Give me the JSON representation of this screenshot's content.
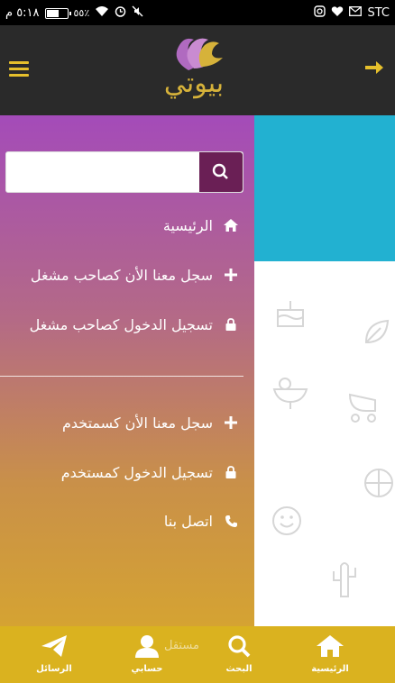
{
  "status_bar": {
    "time": "٥:١٨ م",
    "battery_percent_text": "٥٥٪",
    "battery_level": 0.55,
    "carrier": "STC"
  },
  "header": {
    "logo_text": "بيوتي"
  },
  "drawer": {
    "search": {
      "placeholder": "",
      "value": ""
    },
    "items": [
      {
        "label": "الرئيسية",
        "icon": "home-icon"
      },
      {
        "label": "سجل معنا الأن كصاحب مشغل",
        "icon": "plus-icon"
      },
      {
        "label": "تسجيل الدخول كصاحب مشغل",
        "icon": "lock-icon"
      },
      {
        "label": "سجل معنا الأن كسمتخدم",
        "icon": "plus-icon"
      },
      {
        "label": "تسجيل الدخول كمستخدم",
        "icon": "lock-icon"
      },
      {
        "label": "اتصل بنا",
        "icon": "phone-icon"
      }
    ]
  },
  "bottom_nav": {
    "items": [
      {
        "label": "الرئيسية",
        "icon": "home-icon"
      },
      {
        "label": "البحث",
        "icon": "search-icon"
      },
      {
        "label": "حسابي",
        "icon": "user-icon"
      },
      {
        "label": "الرسائل",
        "icon": "send-icon"
      }
    ],
    "watermark": "مستقل"
  },
  "colors": {
    "header_bg": "#2a2a2a",
    "accent_gold": "#e6c02c",
    "search_button": "#6a1f55",
    "content_cyan": "#22b1d1",
    "bottom_nav_bg": "#dab21f"
  }
}
